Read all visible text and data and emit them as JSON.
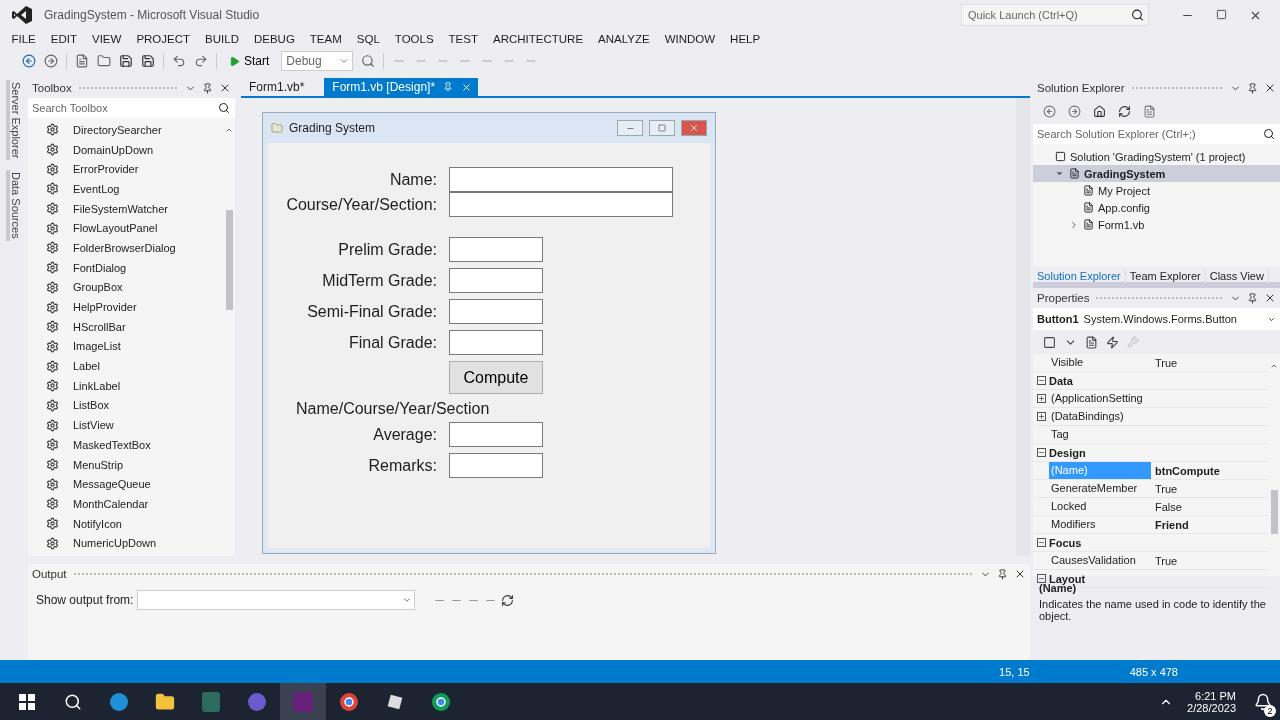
{
  "window": {
    "title": "GradingSystem - Microsoft Visual Studio",
    "quick_launch": {
      "placeholder": "Quick Launch (Ctrl+Q)"
    }
  },
  "menu": [
    "FILE",
    "EDIT",
    "VIEW",
    "PROJECT",
    "BUILD",
    "DEBUG",
    "TEAM",
    "SQL",
    "TOOLS",
    "TEST",
    "ARCHITECTURE",
    "ANALYZE",
    "WINDOW",
    "HELP"
  ],
  "toolbar": {
    "start": "Start",
    "configuration": "Debug"
  },
  "side_tabs": [
    "Server Explorer",
    "Data Sources"
  ],
  "toolbox": {
    "title": "Toolbox",
    "search": {
      "placeholder": "Search Toolbox"
    },
    "items": [
      "DirectorySearcher",
      "DomainUpDown",
      "ErrorProvider",
      "EventLog",
      "FileSystemWatcher",
      "FlowLayoutPanel",
      "FolderBrowserDialog",
      "FontDialog",
      "GroupBox",
      "HelpProvider",
      "HScrollBar",
      "ImageList",
      "Label",
      "LinkLabel",
      "ListBox",
      "ListView",
      "MaskedTextBox",
      "MenuStrip",
      "MessageQueue",
      "MonthCalendar",
      "NotifyIcon",
      "NumericUpDown"
    ]
  },
  "editor_tabs": [
    {
      "label": "Form1.vb*",
      "selected": false
    },
    {
      "label": "Form1.vb [Design]*",
      "selected": true
    }
  ],
  "form": {
    "title": "Grading System",
    "rows": [
      {
        "kind": "wide",
        "label": "Name:"
      },
      {
        "kind": "wide",
        "label": "Course/Year/Section:"
      },
      {
        "kind": "narrow",
        "label": "Prelim Grade:"
      },
      {
        "kind": "narrow",
        "label": "MidTerm Grade:"
      },
      {
        "kind": "narrow",
        "label": "Semi-Final Grade:"
      },
      {
        "kind": "narrow",
        "label": "Final Grade:"
      },
      {
        "kind": "button",
        "label": "Compute"
      },
      {
        "kind": "heading",
        "label": "Name/Course/Year/Section"
      },
      {
        "kind": "narrow",
        "label": "Average:"
      },
      {
        "kind": "narrow",
        "label": "Remarks:"
      }
    ]
  },
  "solution_explorer": {
    "title": "Solution Explorer",
    "search": {
      "placeholder": "Search Solution Explorer (Ctrl+;)"
    },
    "tree": [
      {
        "label": "Solution 'GradingSystem' (1 project)",
        "selected": false,
        "children": [
          {
            "label": "GradingSystem",
            "selected": true,
            "expanded": true,
            "children": [
              {
                "label": "My Project",
                "selected": false
              },
              {
                "label": "App.config",
                "selected": false
              },
              {
                "label": "Form1.vb",
                "selected": false,
                "expanded": false
              }
            ]
          }
        ]
      }
    ],
    "tabs": [
      {
        "label": "Solution Explorer",
        "selected": true
      },
      {
        "label": "Team Explorer",
        "selected": false
      },
      {
        "label": "Class View",
        "selected": false
      }
    ]
  },
  "properties": {
    "title": "Properties",
    "object": "Button1",
    "type": "System.Windows.Forms.Button",
    "rows": [
      {
        "kind": "prop",
        "name": "Visible",
        "value": "True",
        "selected": false,
        "modified": false
      },
      {
        "kind": "category",
        "name": "Data",
        "expanded": true
      },
      {
        "kind": "prop",
        "name": "(ApplicationSetting",
        "selected": false,
        "expanded": false
      },
      {
        "kind": "prop",
        "name": "(DataBindings)",
        "selected": false,
        "expanded": false
      },
      {
        "kind": "prop",
        "name": "Tag",
        "selected": false
      },
      {
        "kind": "category",
        "name": "Design",
        "expanded": true
      },
      {
        "kind": "prop",
        "name": "(Name)",
        "value": "btnCompute",
        "selected": true,
        "modified": true
      },
      {
        "kind": "prop",
        "name": "GenerateMember",
        "value": "True",
        "selected": false,
        "modified": false
      },
      {
        "kind": "prop",
        "name": "Locked",
        "value": "False",
        "selected": false,
        "modified": false
      },
      {
        "kind": "prop",
        "name": "Modifiers",
        "value": "Friend",
        "selected": false,
        "modified": true
      },
      {
        "kind": "category",
        "name": "Focus",
        "expanded": true
      },
      {
        "kind": "prop",
        "name": "CausesValidation",
        "value": "True",
        "selected": false,
        "modified": false
      },
      {
        "kind": "category",
        "name": "Layout",
        "expanded": true
      }
    ],
    "description": {
      "title": "(Name)",
      "text": "Indicates the name used in code to identify the object."
    }
  },
  "output": {
    "title": "Output",
    "show_from": "Show output from:"
  },
  "status_bar": {
    "position": "15, 15",
    "size": "485 x 478"
  },
  "taskbar": {
    "time": "6:21 PM",
    "date": "2/28/2023",
    "notifications": "2"
  }
}
